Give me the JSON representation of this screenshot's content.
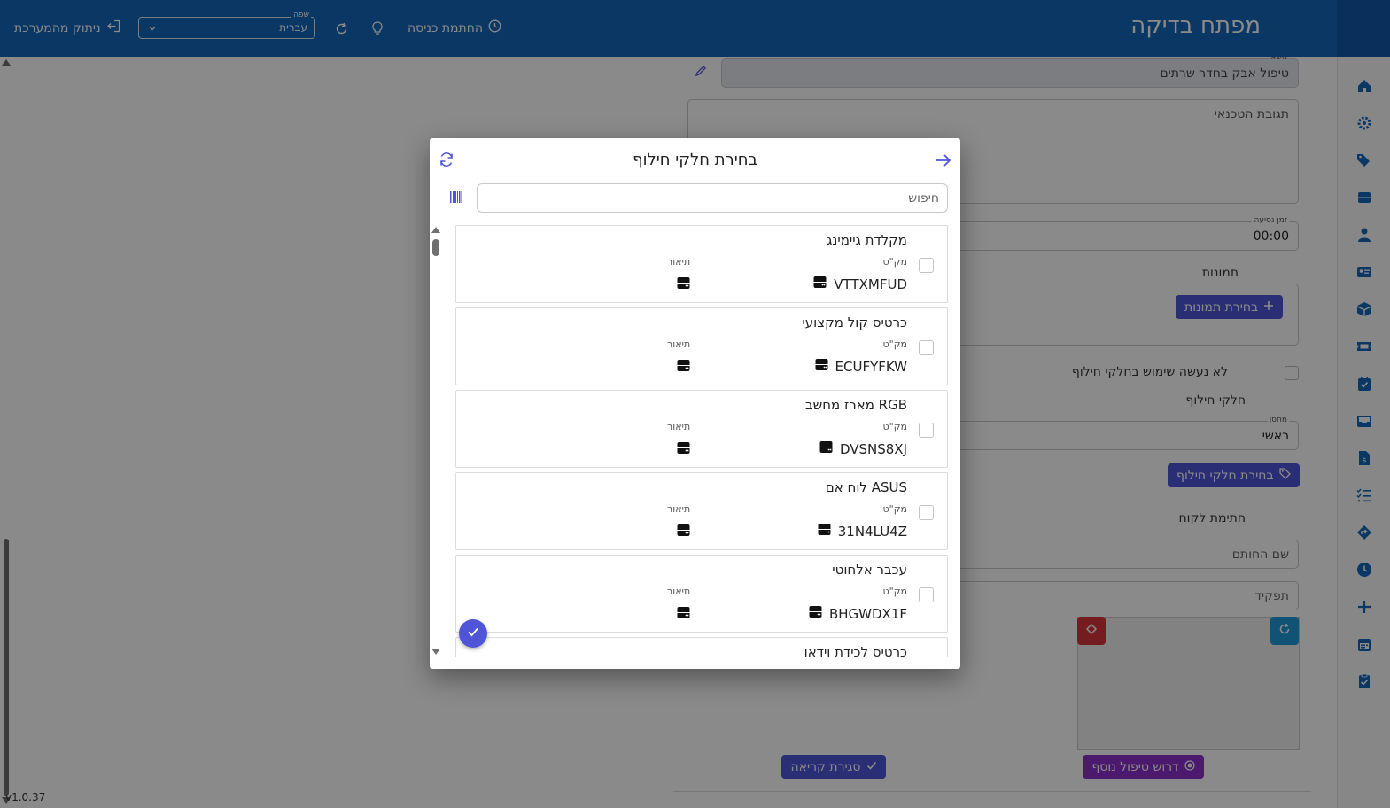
{
  "app": {
    "title": "מפתח בדיקה",
    "checkin_label": "החתמת כניסה",
    "logout_label": "ניתוק מהמערכת",
    "language_label": "שפה",
    "language_value": "עברית",
    "version": "v1.0.37"
  },
  "form": {
    "subject_label": "נושא",
    "subject_value": "טיפול אבק בחדר שרתים",
    "tech_response_placeholder": "תגובת הטכנאי",
    "travel_time_label": "זמן נסיעה",
    "travel_time_value": "00:00",
    "images_section": "תמונות",
    "choose_images_label": "בחירת תמונות",
    "no_parts_used_label": "לא נעשה שימוש בחלקי חילוף",
    "spare_parts_section": "חלקי חילוף",
    "warehouse_label": "מחסן",
    "warehouse_value": "ראשי",
    "choose_spare_parts_label": "בחירת חלקי חילוף",
    "customer_signature_section": "חתימת לקוח",
    "signer_name_placeholder": "שם החותם",
    "role_placeholder": "תפקיד",
    "request_followup_label": "דרוש טיפול נוסף",
    "close_call_label": "סגירת קריאה"
  },
  "dialog": {
    "title": "בחירת חלקי חילוף",
    "search_placeholder": "חיפוש",
    "sku_label": "מק\"ט",
    "desc_label": "תיאור",
    "items": [
      {
        "name": "מקלדת גיימינג",
        "sku": "VTTXMFUD"
      },
      {
        "name": "כרטיס קול מקצועי",
        "sku": "ECUFYFKW"
      },
      {
        "name": "מארז מחשב RGB",
        "sku": "DVSNS8XJ"
      },
      {
        "name": "לוח אם ASUS",
        "sku": "31N4LU4Z"
      },
      {
        "name": "עכבר אלחוטי",
        "sku": "BHGWDX1F"
      },
      {
        "name": "כרטיס לכידת וידאו",
        "sku": ""
      }
    ]
  },
  "colors": {
    "primary": "#1466b8",
    "accent": "#4f55d6",
    "purple": "#8b2fc9",
    "danger": "#d6353a",
    "info": "#1e9ad6"
  }
}
